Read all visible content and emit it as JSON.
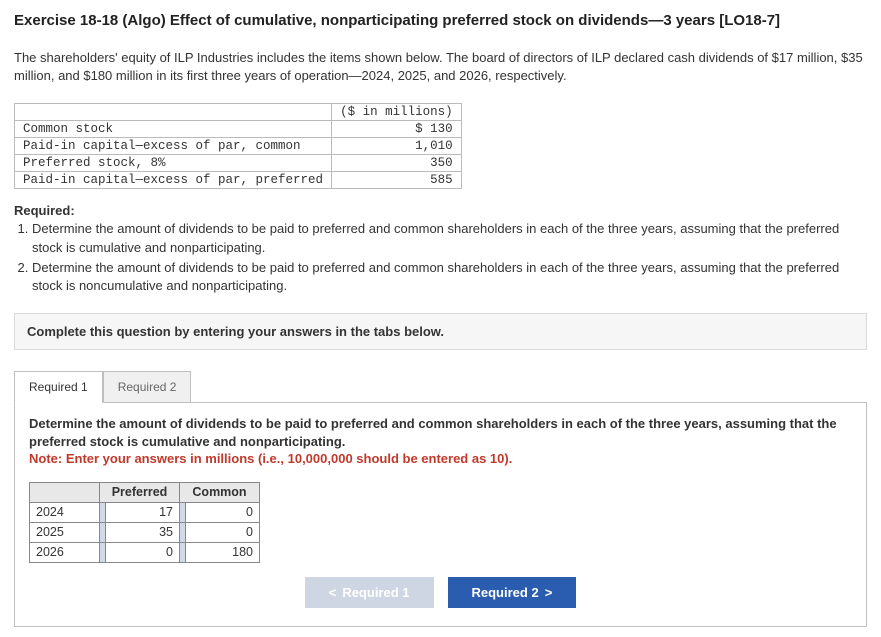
{
  "title": "Exercise 18-18 (Algo) Effect of cumulative, nonparticipating preferred stock on dividends—3 years [LO18-7]",
  "intro": "The shareholders' equity of ILP Industries includes the items shown below. The board of directors of ILP declared cash dividends of $17 million, $35 million, and $180 million in its first three years of operation—2024, 2025, and 2026, respectively.",
  "equity": {
    "header": "($ in millions)",
    "rows": [
      {
        "label": "Common stock",
        "value": "$ 130"
      },
      {
        "label": "Paid-in capital—excess of par, common",
        "value": "1,010"
      },
      {
        "label": "Preferred stock, 8%",
        "value": "350"
      },
      {
        "label": "Paid-in capital—excess of par, preferred",
        "value": "585"
      }
    ]
  },
  "required_label": "Required:",
  "required": [
    "Determine the amount of dividends to be paid to preferred and common shareholders in each of the three years, assuming that the preferred stock is cumulative and nonparticipating.",
    "Determine the amount of dividends to be paid to preferred and common shareholders in each of the three years, assuming that the preferred stock is noncumulative and nonparticipating."
  ],
  "instruction": "Complete this question by entering your answers in the tabs below.",
  "tabs": {
    "tab1": "Required 1",
    "tab2": "Required 2"
  },
  "tab_panel": {
    "instr": "Determine the amount of dividends to be paid to preferred and common shareholders in each of the three years, assuming that the preferred stock is cumulative and nonparticipating.",
    "note": "Note: Enter your answers in millions (i.e., 10,000,000 should be entered as 10).",
    "col1": "Preferred",
    "col2": "Common",
    "rows": [
      {
        "year": "2024",
        "preferred": "17",
        "common": "0"
      },
      {
        "year": "2025",
        "preferred": "35",
        "common": "0"
      },
      {
        "year": "2026",
        "preferred": "0",
        "common": "180"
      }
    ]
  },
  "nav": {
    "prev": "Required 1",
    "next": "Required 2"
  }
}
